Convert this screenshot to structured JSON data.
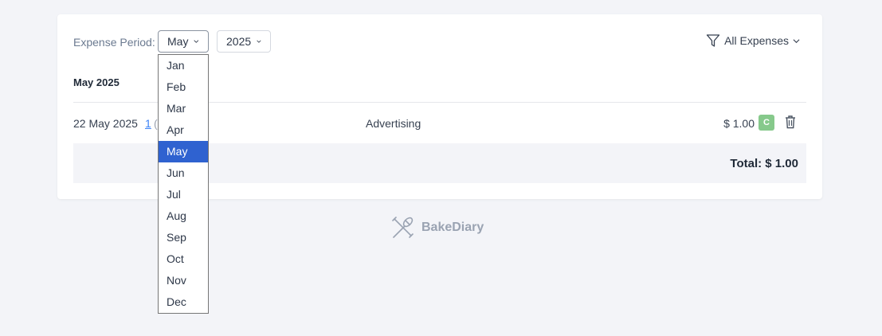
{
  "filters": {
    "period_label": "Expense Period:",
    "month_selected": "May",
    "year_selected": "2025",
    "category_filter": "All Expenses"
  },
  "month_heading": "May 2025",
  "expense_row": {
    "date": "22 May 2025",
    "link_text": "1",
    "paren": "(",
    "category": "Advertising",
    "amount": "$ 1.00",
    "badge": "C"
  },
  "total": "Total: $ 1.00",
  "brand_name": "BakeDiary",
  "month_options": [
    {
      "label": "Jan"
    },
    {
      "label": "Feb"
    },
    {
      "label": "Mar"
    },
    {
      "label": "Apr"
    },
    {
      "label": "May",
      "selected": true
    },
    {
      "label": "Jun"
    },
    {
      "label": "Jul"
    },
    {
      "label": "Aug"
    },
    {
      "label": "Sep"
    },
    {
      "label": "Oct"
    },
    {
      "label": "Nov"
    },
    {
      "label": "Dec"
    }
  ],
  "colors": {
    "accent": "#2f62d0",
    "badge_green": "#86c98b",
    "page_bg": "#f3f4f8"
  },
  "icons": {
    "filter": "funnel-icon",
    "dropdown": "chevron-down-icon",
    "delete": "trash-icon",
    "logo": "crossed-whisk-rolling-pin-icon"
  }
}
